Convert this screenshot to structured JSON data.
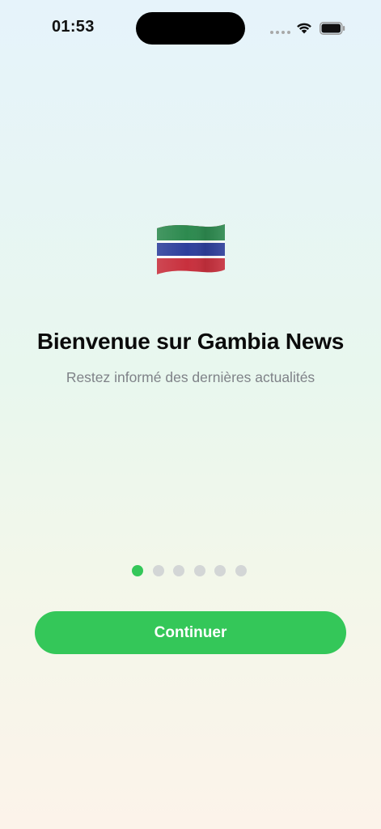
{
  "status_bar": {
    "time": "01:53",
    "wifi_icon": "wifi-icon",
    "battery_icon": "battery-icon"
  },
  "onboarding": {
    "flag_icon": "gambia-flag-icon",
    "title": "Bienvenue sur Gambia News",
    "subtitle": "Restez informé des dernières actualités",
    "pager": {
      "total_pages": 6,
      "current_page": 1
    },
    "continue_label": "Continuer"
  },
  "colors": {
    "accent": "#34c759",
    "title": "#0b0b0b",
    "subtitle": "#7f8288",
    "inactive_dot": "#d3d6d6"
  }
}
